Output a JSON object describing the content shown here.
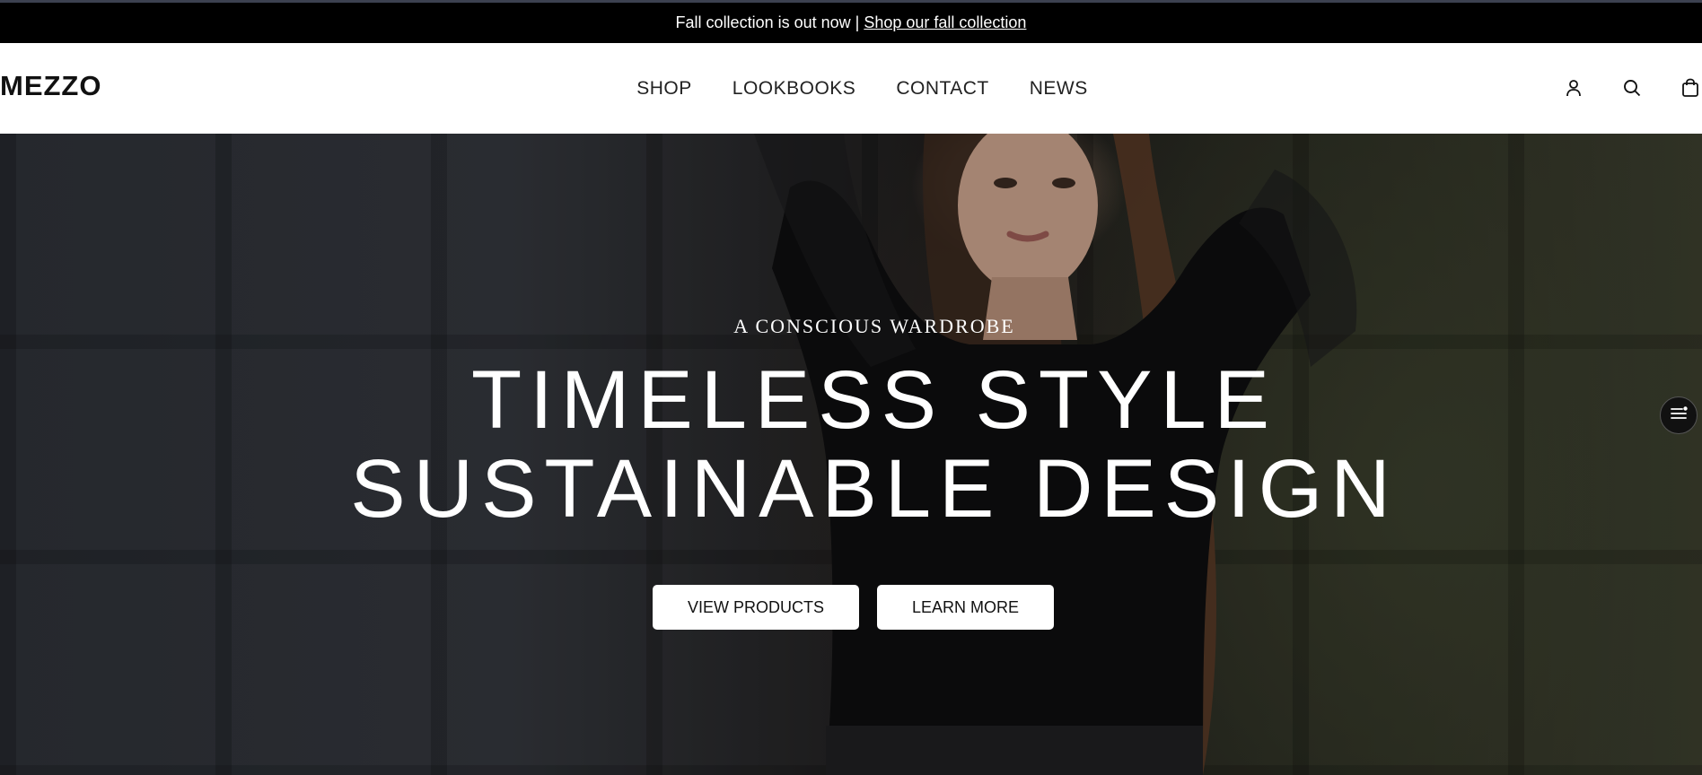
{
  "announcement": {
    "text": "Fall collection is out now",
    "separator": "|",
    "link_label": "Shop our fall collection"
  },
  "header": {
    "logo": "MEZZO",
    "nav": [
      {
        "label": "SHOP"
      },
      {
        "label": "LOOKBOOKS"
      },
      {
        "label": "CONTACT"
      },
      {
        "label": "NEWS"
      }
    ],
    "icons": [
      "account-icon",
      "search-icon",
      "cart-icon"
    ]
  },
  "hero": {
    "eyebrow": "A CONSCIOUS WARDROBE",
    "headline_line1": "TIMELESS STYLE",
    "headline_line2": "SUSTAINABLE DESIGN",
    "primary_cta": "VIEW PRODUCTS",
    "secondary_cta": "LEARN MORE"
  },
  "widget": {
    "icon": "menu-settings-icon"
  },
  "colors": {
    "announcement_bg": "#000000",
    "header_bg": "#ffffff",
    "button_bg": "#ffffff",
    "text_light": "#ffffff",
    "text_dark": "#111111"
  }
}
